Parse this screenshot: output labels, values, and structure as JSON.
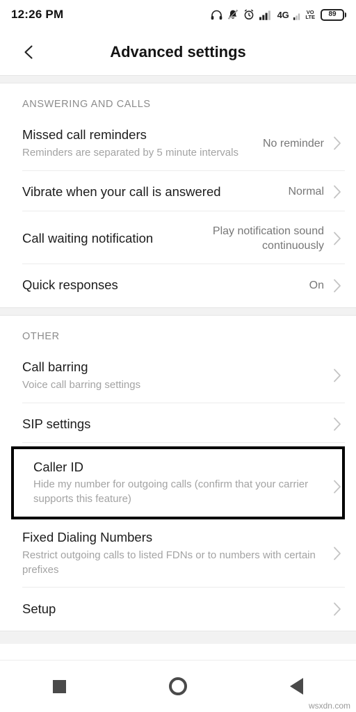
{
  "status_bar": {
    "time": "12:26 PM",
    "network_label": "4G",
    "volte_top": "VO",
    "volte_bottom": "LTE",
    "battery_level": "89",
    "icons": [
      "headphones-icon",
      "mute-bell-icon",
      "alarm-icon",
      "signal-bars-icon",
      "network-4g-icon",
      "volte-icon",
      "battery-icon"
    ]
  },
  "appbar": {
    "back_icon": "back-arrow-icon",
    "title": "Advanced settings"
  },
  "sections": [
    {
      "header": "ANSWERING AND CALLS",
      "rows": [
        {
          "title": "Missed call reminders",
          "subtitle": "Reminders are separated by 5 minute intervals",
          "value": "No reminder",
          "chevron": true
        },
        {
          "title": "Vibrate when your call is answered",
          "subtitle": "",
          "value": "Normal",
          "chevron": true
        },
        {
          "title": "Call waiting notification",
          "subtitle": "",
          "value": "Play notification sound continuously",
          "chevron": true
        },
        {
          "title": "Quick responses",
          "subtitle": "",
          "value": "On",
          "chevron": true
        }
      ]
    },
    {
      "header": "OTHER",
      "rows": [
        {
          "title": "Call barring",
          "subtitle": "Voice call barring settings",
          "value": "",
          "chevron": true
        },
        {
          "title": "SIP settings",
          "subtitle": "",
          "value": "",
          "chevron": true
        },
        {
          "title": "Caller ID",
          "subtitle": "Hide my number for outgoing calls (confirm that your carrier supports this feature)",
          "value": "",
          "chevron": true,
          "highlighted": true
        },
        {
          "title": "Fixed Dialing Numbers",
          "subtitle": "Restrict outgoing calls to listed FDNs or to numbers with certain prefixes",
          "value": "",
          "chevron": true
        },
        {
          "title": "Setup",
          "subtitle": "",
          "value": "",
          "chevron": true
        }
      ]
    }
  ],
  "navbar": {
    "recent_label": "recents-button",
    "home_label": "home-button",
    "back_label": "back-button"
  },
  "watermark": "wsxdn.com",
  "colors": {
    "background": "#ffffff",
    "section_divider": "#f2f2f2",
    "title_text": "#1c1c1c",
    "subtitle_text": "#a3a3a3",
    "value_text": "#777777",
    "highlight_border": "#000000"
  }
}
